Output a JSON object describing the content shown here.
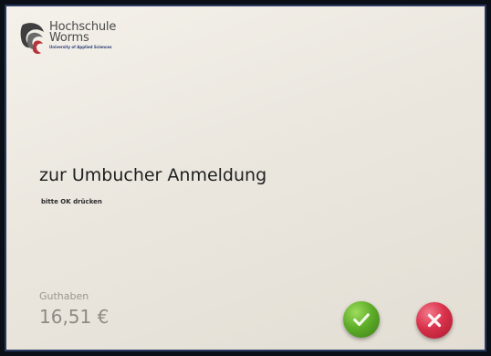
{
  "logo": {
    "line1": "Hochschule",
    "line2": "Worms",
    "subtitle": "University of Applied Sciences"
  },
  "main": {
    "headline": "zur Umbucher Anmeldung",
    "hint": "bitte OK drücken"
  },
  "balance": {
    "label": "Guthaben",
    "value": "16,51 €"
  },
  "actions": {
    "ok_icon": "check-icon",
    "cancel_icon": "close-icon"
  },
  "colors": {
    "ok": "#5fae2a",
    "cancel": "#d9324b",
    "frame": "#2a3a60"
  }
}
